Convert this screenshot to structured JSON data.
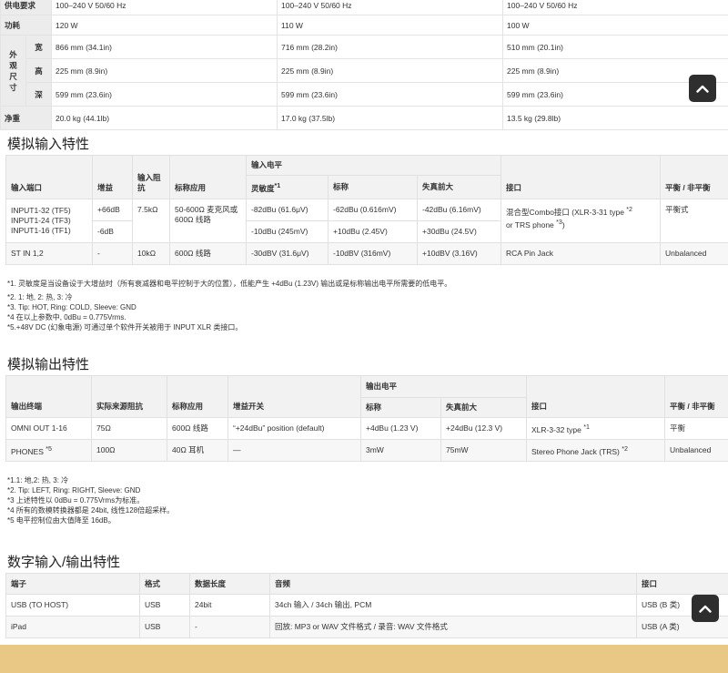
{
  "top": {
    "rows": [
      {
        "label": "供电要求",
        "c1": "100–240 V 50/60 Hz",
        "c2": "100–240 V 50/60 Hz",
        "c3": "100–240 V 50/60 Hz"
      },
      {
        "label": "功耗",
        "c1": "120 W",
        "c2": "110 W",
        "c3": "100 W"
      }
    ],
    "dim_label": "外观尺寸",
    "dims": [
      {
        "label": "宽",
        "c1": "866 mm (34.1in)",
        "c2": "716 mm (28.2in)",
        "c3": "510 mm (20.1in)"
      },
      {
        "label": "高",
        "c1": "225 mm (8.9in)",
        "c2": "225 mm (8.9in)",
        "c3": "225 mm (8.9in)"
      },
      {
        "label": "深",
        "c1": "599 mm (23.6in)",
        "c2": "599 mm (23.6in)",
        "c3": "599 mm (23.6in)"
      }
    ],
    "weight": {
      "label": "净重",
      "c1": "20.0 kg (44.1lb)",
      "c2": "17.0 kg (37.5lb)",
      "c3": "13.5 kg (29.8lb)"
    }
  },
  "analog_in": {
    "title": "模拟输入特性",
    "h_port": "输入端口",
    "h_gain": "增益",
    "h_imp": "输入阻抗",
    "h_app": "标称应用",
    "h_level": "输入电平",
    "h_sens": "灵敏度",
    "h_sens_sup": "*1",
    "h_nom": "标称",
    "h_max": "失真前大",
    "h_conn": "接口",
    "h_bal": "平衡 / 非平衡",
    "r1_port": "INPUT1-32 (TF5) INPUT1-24 (TF3) INPUT1-16 (TF1)",
    "r1_gain1": "+66dB",
    "r1_gain2": "-6dB",
    "r1_imp": "7.5kΩ",
    "r1_app": "50-600Ω 麦克风或 600Ω 线路",
    "r1_sens1": "-82dBu (61.6μV)",
    "r1_nom1": "-62dBu (0.616mV)",
    "r1_max1": "-42dBu (6.16mV)",
    "r1_sens2": "-10dBu (245mV)",
    "r1_nom2": "+10dBu (2.45V)",
    "r1_max2": "+30dBu (24.5V)",
    "r1_conn": "混合型Combo接口 (XLR-3-31 type",
    "r1_conn_sup": "*2",
    "r1_conn2": "or TRS phone",
    "r1_conn2_sup": "*3",
    "r1_conn2_end": ")",
    "r1_bal": "平衡式",
    "r2_port": "ST IN 1,2",
    "r2_gain": "-",
    "r2_imp": "10kΩ",
    "r2_app": "600Ω 线路",
    "r2_sens": "-30dBV (31.6μV)",
    "r2_nom": "-10dBV (316mV)",
    "r2_max": "+10dBV (3.16V)",
    "r2_conn": "RCA Pin Jack",
    "r2_bal": "Unbalanced",
    "notes": [
      "*1. 灵敏度是当设备设于大增益时（所有衰减器和电平控制于大的位置），低能产生 +4dBu (1.23V) 输出或是标称输出电平所需要的低电平。",
      "*2. 1: 地, 2: 热, 3: 冷",
      "*3. Tip: HOT, Ring: COLD, Sleeve: GND",
      "*4 在以上参数中, 0dBu = 0.775Vrms.",
      "*5.+48V DC (幻象电源) 可通过单个软件开关被用于 INPUT XLR 类接口。"
    ]
  },
  "analog_out": {
    "title": "模拟输出特性",
    "h_term": "输出终端",
    "h_src": "实际来源阻抗",
    "h_app": "标称应用",
    "h_gainsw": "增益开关",
    "h_level": "输出电平",
    "h_nom": "标称",
    "h_max": "失真前大",
    "h_conn": "接口",
    "h_bal": "平衡 / 非平衡",
    "r1_term": "OMNI OUT 1-16",
    "r1_src": "75Ω",
    "r1_app": "600Ω 线路",
    "r1_gainsw": "“+24dBu” position (default)",
    "r1_nom": "+4dBu (1.23 V)",
    "r1_max": "+24dBu (12.3 V)",
    "r1_conn": "XLR-3-32 type",
    "r1_conn_sup": "*1",
    "r1_bal": "平衡",
    "r2_term": "PHONES",
    "r2_term_sup": "*5",
    "r2_src": "100Ω",
    "r2_app": "40Ω 耳机",
    "r2_gainsw": "—",
    "r2_nom": "3mW",
    "r2_max": "75mW",
    "r2_conn": "Stereo Phone Jack (TRS)",
    "r2_conn_sup": "*2",
    "r2_bal": "Unbalanced",
    "notes": [
      "*1.1: 地,2: 热, 3: 冷",
      "*2. Tip: LEFT, Ring: RIGHT, Sleeve: GND",
      "*3 上述特性以 0dBu = 0.775Vrms为标准。",
      "*4 所有的数模转换器都是 24bit, 线性128倍超采样。",
      "*5 电平控制位由大值降至 16dB。"
    ]
  },
  "digital": {
    "title": "数字输入/输出特性",
    "h_term": "端子",
    "h_fmt": "格式",
    "h_len": "数据长度",
    "h_audio": "音频",
    "h_conn": "接口",
    "r1_term": "USB (TO HOST)",
    "r1_fmt": "USB",
    "r1_len": "24bit",
    "r1_audio": "34ch 输入 / 34ch 输出, PCM",
    "r1_conn": "USB (B 类)",
    "r2_term": "iPad",
    "r2_fmt": "USB",
    "r2_len": "-",
    "r2_audio": "回放: MP3 or WAV 文件格式 / 录音: WAV 文件格式",
    "r2_conn": "USB (A 类)"
  },
  "colors": {
    "page_bg": "#e9c784",
    "fab_bg": "#2e2e2e"
  },
  "icons": {
    "scroll_top": "chevron-up-icon"
  }
}
